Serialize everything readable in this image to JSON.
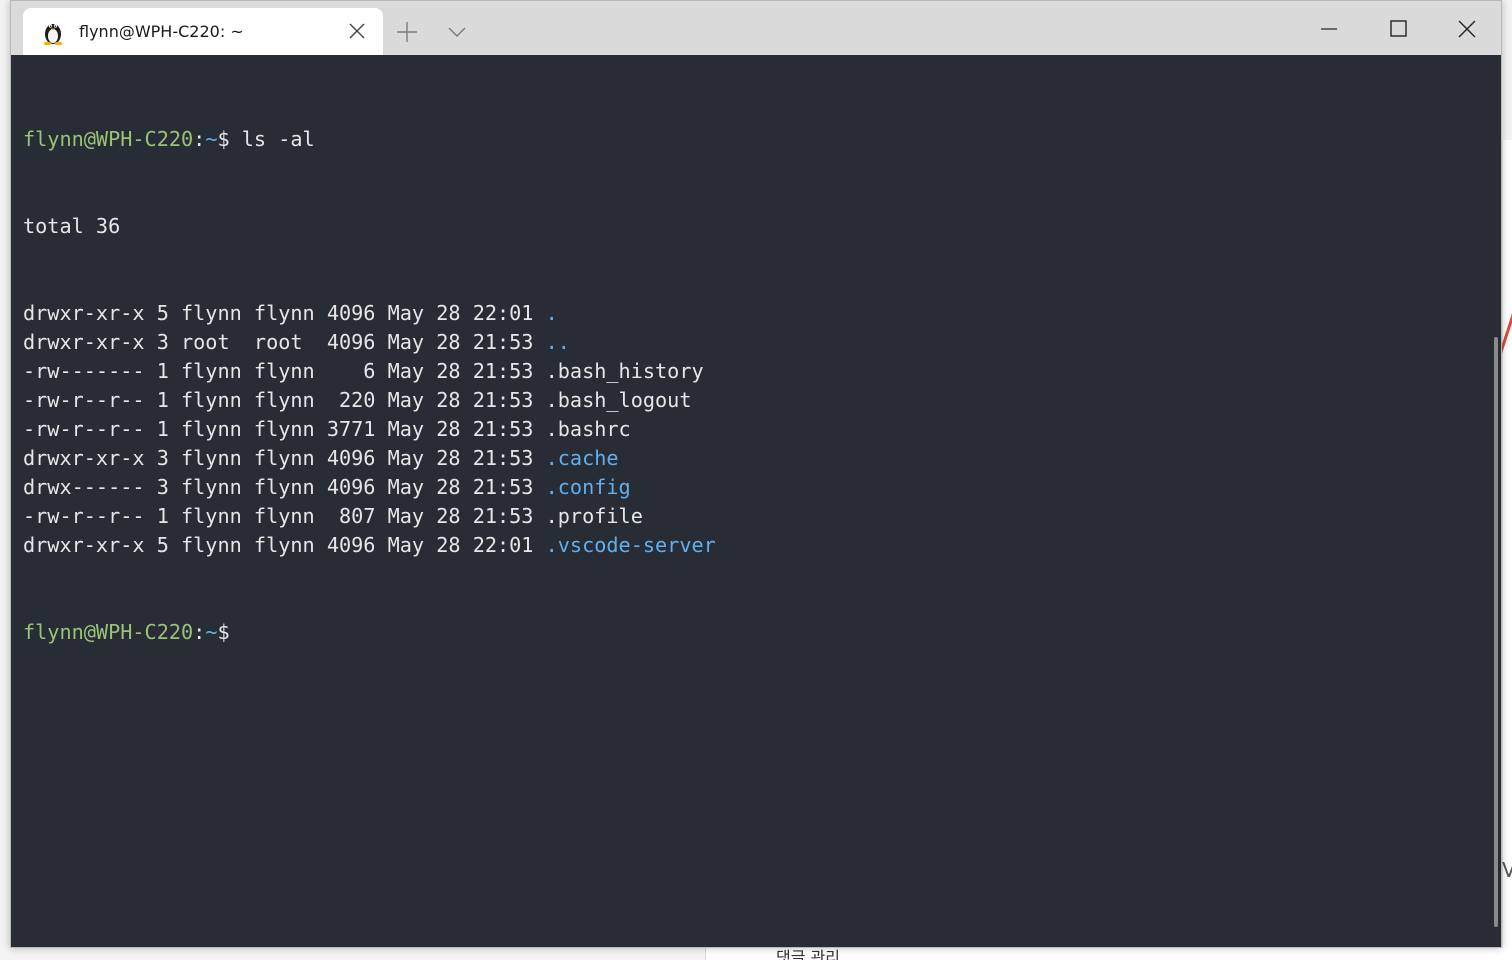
{
  "window": {
    "tab_title": "flynn@WPH-C220: ~",
    "tab_icon": "linux-penguin-icon"
  },
  "background": {
    "bottom_text": "댓글 관리",
    "right_letter": "V"
  },
  "colors": {
    "terminal_bg": "#282c34",
    "titlebar_bg": "#dadada",
    "prompt_user": "#98c379",
    "prompt_path": "#61afef",
    "directory": "#61afef",
    "text": "#e6e6e6"
  },
  "terminal": {
    "prompt_user": "flynn@WPH-C220",
    "prompt_sep": ":",
    "prompt_path": "~",
    "prompt_dollar": "$",
    "command": " ls -al",
    "total_line": "total 36",
    "entries": [
      {
        "meta": "drwxr-xr-x 5 flynn flynn 4096 May 28 22:01 ",
        "name": ".",
        "is_dir": true
      },
      {
        "meta": "drwxr-xr-x 3 root  root  4096 May 28 21:53 ",
        "name": "..",
        "is_dir": true
      },
      {
        "meta": "-rw------- 1 flynn flynn    6 May 28 21:53 ",
        "name": ".bash_history",
        "is_dir": false
      },
      {
        "meta": "-rw-r--r-- 1 flynn flynn  220 May 28 21:53 ",
        "name": ".bash_logout",
        "is_dir": false
      },
      {
        "meta": "-rw-r--r-- 1 flynn flynn 3771 May 28 21:53 ",
        "name": ".bashrc",
        "is_dir": false
      },
      {
        "meta": "drwxr-xr-x 3 flynn flynn 4096 May 28 21:53 ",
        "name": ".cache",
        "is_dir": true
      },
      {
        "meta": "drwx------ 3 flynn flynn 4096 May 28 21:53 ",
        "name": ".config",
        "is_dir": true
      },
      {
        "meta": "-rw-r--r-- 1 flynn flynn  807 May 28 21:53 ",
        "name": ".profile",
        "is_dir": false
      },
      {
        "meta": "drwxr-xr-x 5 flynn flynn 4096 May 28 22:01 ",
        "name": ".vscode-server",
        "is_dir": true
      }
    ]
  }
}
